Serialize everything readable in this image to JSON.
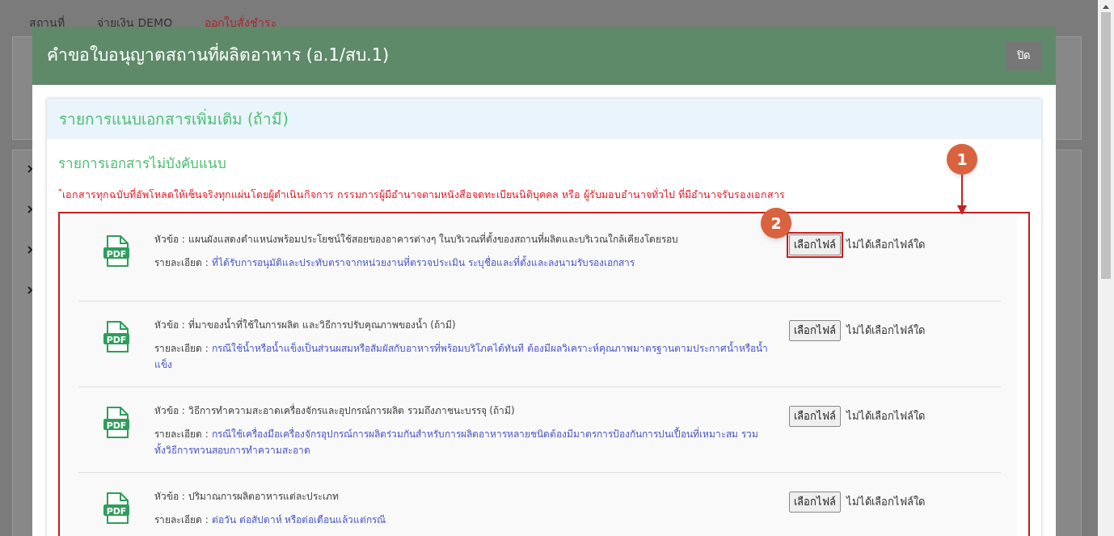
{
  "background": {
    "tabs": [
      {
        "label": "สถานที่",
        "selected": false
      },
      {
        "label": "จ่ายเงิน DEMO",
        "selected": false
      },
      {
        "label": "ออกใบสั่งชำระ",
        "selected": true
      }
    ]
  },
  "modal": {
    "title": "คำขอใบอนุญาตสถานที่ผลิตอาหาร (อ.1/สบ.1)",
    "close_button": "ปิด",
    "section_title": "รายการแนบเอกสารเพิ่มเติม (ถ้ามี)",
    "subsection_title": "รายการเอกสารไม่บังคับแนบ",
    "note_marker": "*",
    "note": "เอกสารทุกฉบับที่อัพโหลดให้เซ็นจริงทุกแผ่นโดยผู้ดำเนินกิจการ กรรมการผู้มีอำนาจตามหนังสือจดทะเบียนนิติบุคคล หรือ ผู้รับมอบอำนาจทั่วไป ที่มีอำนาจรับรองเอกสาร",
    "documents": [
      {
        "icon_text": "PDF",
        "topic_label": "หัวข้อ :",
        "topic": "แผนผังแสดงตำแหน่งพร้อมประโยชน์ใช้สอยของอาคารต่างๆ ในบริเวณที่ตั้งของสถานที่ผลิตและบริเวณใกล้เคียงโดยรอบ",
        "detail_label": "รายละเอียด :",
        "detail": "ที่ได้รับการอนุมัติและประทับตราจากหน่วยงานที่ตรวจประเมิน ระบุชื่อและที่ตั้งและลงนามรับรองเอกสาร",
        "button": "เลือกไฟล์",
        "file_status": "ไม่ได้เลือกไฟล์ใด",
        "highlighted": true
      },
      {
        "icon_text": "PDF",
        "topic_label": "หัวข้อ :",
        "topic": "ที่มาของน้ำที่ใช้ในการผลิต และวิธีการปรับคุณภาพของน้ำ (ถ้ามี)",
        "detail_label": "รายละเอียด :",
        "detail": "กรณีใช้น้ำหรือน้ำแข็งเป็นส่วนผสมหรือสัมผัสกับอาหารที่พร้อมบริโภคได้ทันที ต้องมีผลวิเคราะห์คุณภาพมาตรฐานตามประกาศน้ำหรือน้ำแข็ง",
        "button": "เลือกไฟล์",
        "file_status": "ไม่ได้เลือกไฟล์ใด",
        "highlighted": false
      },
      {
        "icon_text": "PDF",
        "topic_label": "หัวข้อ :",
        "topic": "วิธีการทำความสะอาดเครื่องจักรและอุปกรณ์การผลิต รวมถึงภาชนะบรรจุ (ถ้ามี)",
        "detail_label": "รายละเอียด :",
        "detail": "กรณีใช้เครื่องมือเครื่องจักรอุปกรณ์การผลิตร่วมกันสำหรับการผลิตอาหารหลายชนิดต้องมีมาตรการป้องกันการปนเปื้อนที่เหมาะสม รวมทั้งวิธีการทวนสอบการทำความสะอาด",
        "button": "เลือกไฟล์",
        "file_status": "ไม่ได้เลือกไฟล์ใด",
        "highlighted": false
      },
      {
        "icon_text": "PDF",
        "topic_label": "หัวข้อ :",
        "topic": "ปริมาณการผลิตอาหารแต่ละประเภท",
        "detail_label": "รายละเอียด :",
        "detail": "ต่อวัน ต่อสัปดาห์ หรือต่อเดือนแล้วแต่กรณี",
        "button": "เลือกไฟล์",
        "file_status": "ไม่ได้เลือกไฟล์ใด",
        "highlighted": false
      }
    ]
  },
  "annotations": [
    {
      "kind": "arrow",
      "number": "1"
    },
    {
      "kind": "badge",
      "number": "2"
    }
  ]
}
